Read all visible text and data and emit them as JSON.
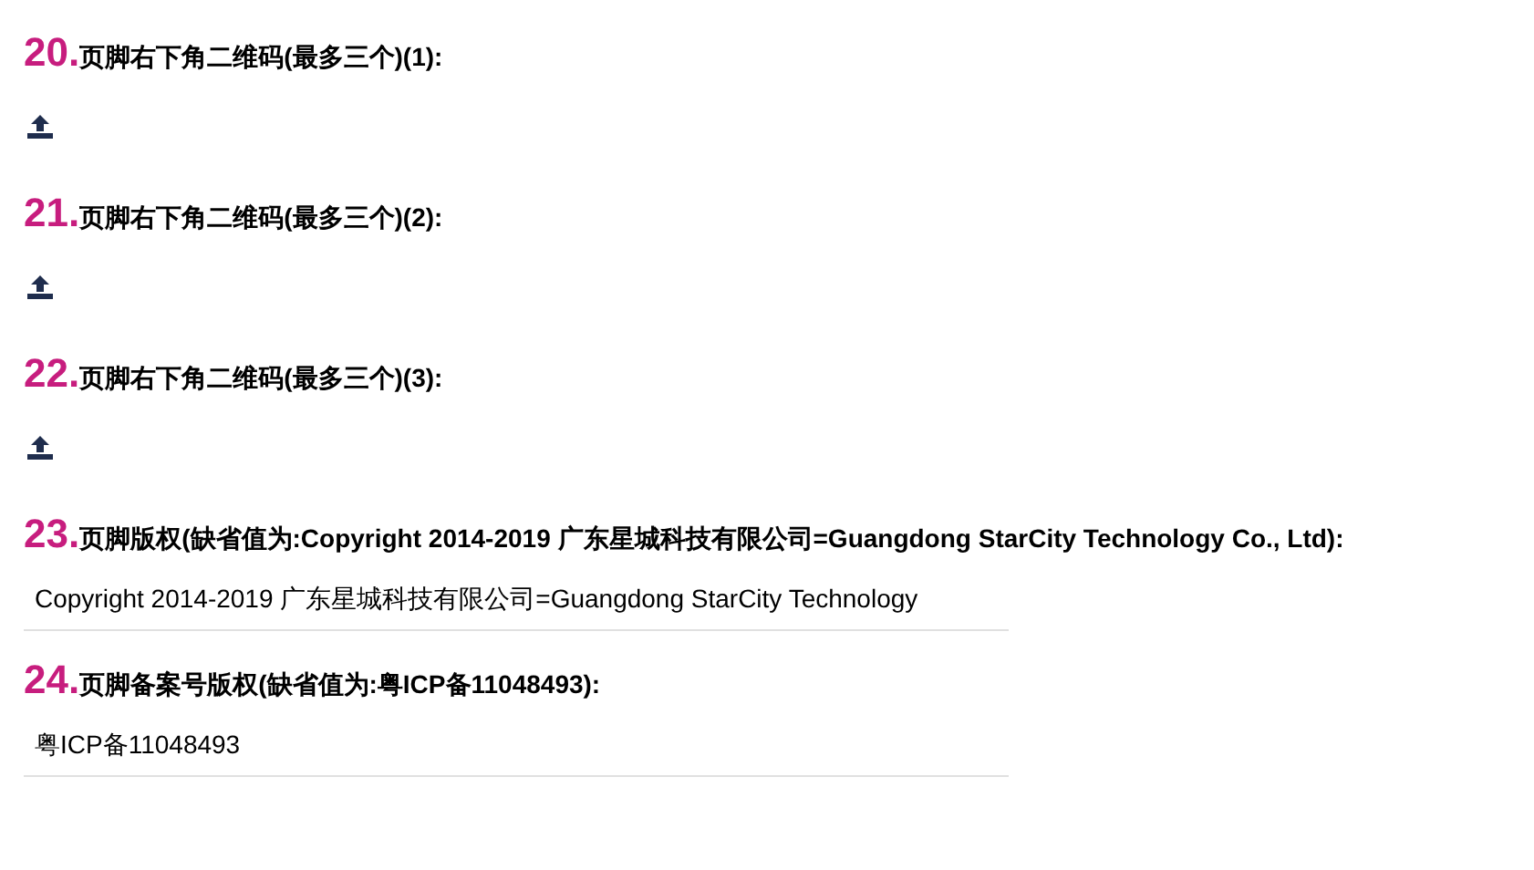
{
  "fields": [
    {
      "number": "20.",
      "label": "页脚右下角二维码(最多三个)(1):",
      "kind": "upload"
    },
    {
      "number": "21.",
      "label": "页脚右下角二维码(最多三个)(2):",
      "kind": "upload"
    },
    {
      "number": "22.",
      "label": "页脚右下角二维码(最多三个)(3):",
      "kind": "upload"
    },
    {
      "number": "23.",
      "label": "页脚版权(缺省值为:Copyright 2014-2019 广东星城科技有限公司=Guangdong StarCity Technology Co., Ltd):",
      "kind": "text",
      "value": "Copyright 2014-2019 广东星城科技有限公司=Guangdong StarCity Technology"
    },
    {
      "number": "24.",
      "label": "页脚备案号版权(缺省值为:粤ICP备11048493):",
      "kind": "text",
      "value": "粤ICP备11048493"
    }
  ]
}
